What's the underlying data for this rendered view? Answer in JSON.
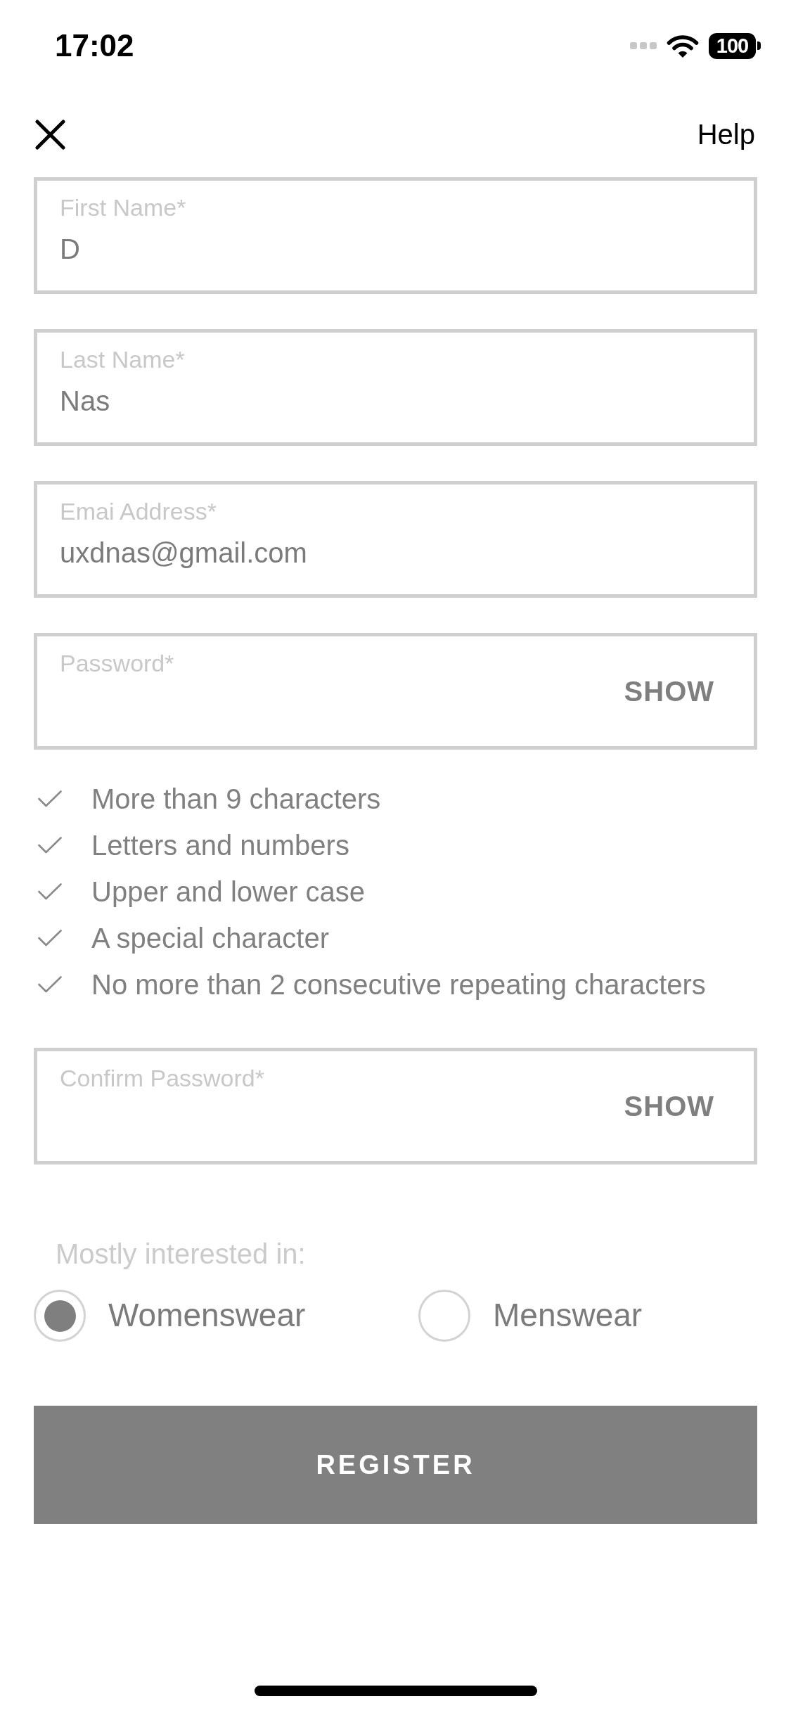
{
  "status_bar": {
    "time": "17:02",
    "battery": "100"
  },
  "header": {
    "help_link": "Help"
  },
  "fields": [
    {
      "kind": "text",
      "label": "First Name*",
      "value": "D"
    },
    {
      "kind": "text",
      "label": "Last Name*",
      "value": "Nas"
    },
    {
      "kind": "text",
      "label": "Emai Address*",
      "value": "uxdnas@gmail.com"
    },
    {
      "kind": "password",
      "label": "Password*",
      "toggle": "SHOW"
    }
  ],
  "password_rules": [
    "More than 9 characters",
    "Letters and numbers",
    "Upper and lower case",
    "A special character",
    "No more than 2 consecutive repeating characters"
  ],
  "confirm_password_field": {
    "kind": "password",
    "label": "Confirm Password*",
    "toggle": "SHOW"
  },
  "interest": {
    "label": "Mostly interested in:",
    "options": [
      {
        "label": "Womenswear",
        "selected": true
      },
      {
        "label": "Menswear",
        "selected": false
      }
    ]
  },
  "register_button": "REGISTER"
}
